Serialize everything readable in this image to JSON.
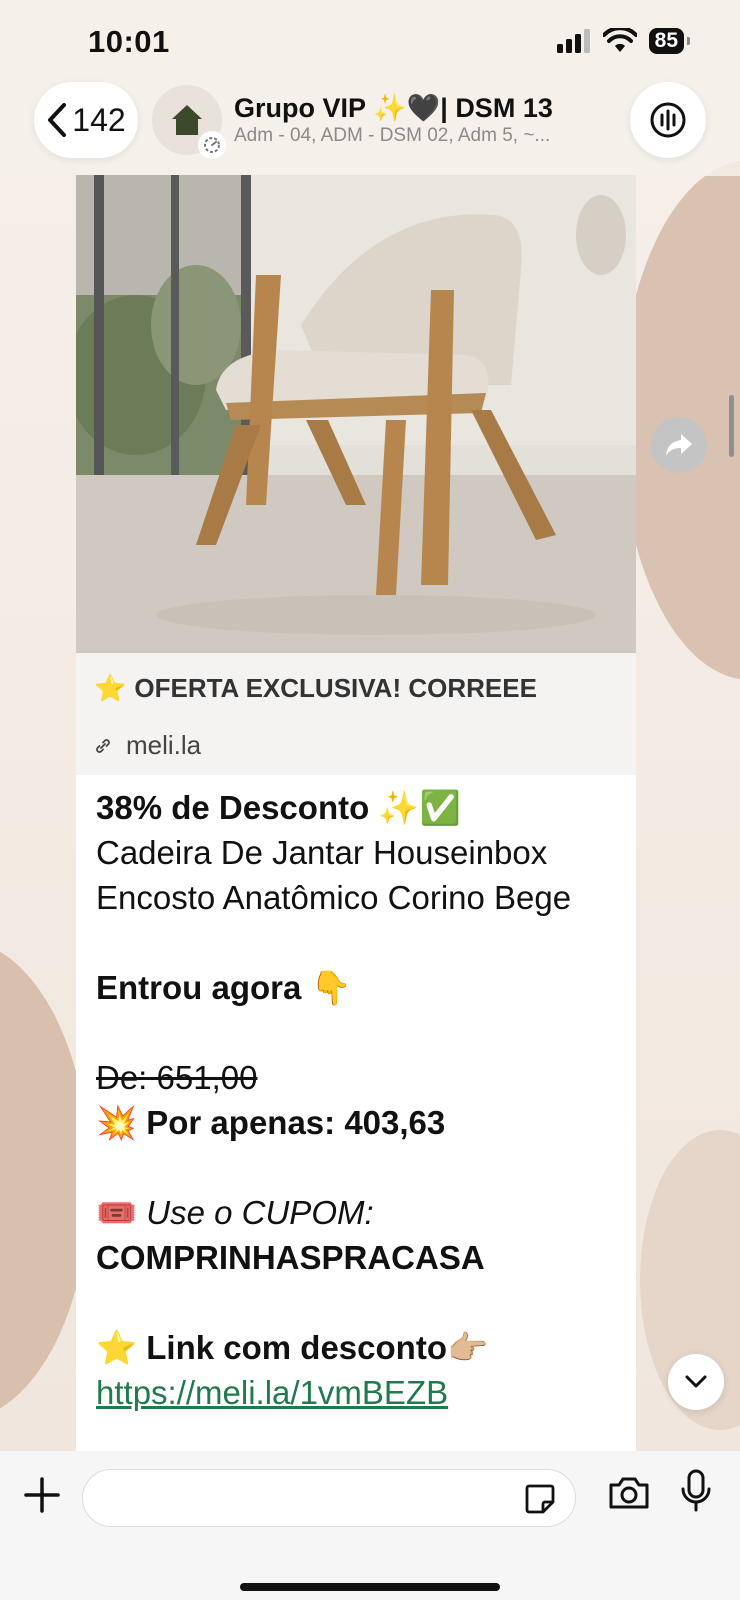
{
  "status": {
    "time": "10:01",
    "battery": "85"
  },
  "header": {
    "back_count": "142",
    "group_title": "Grupo VIP ✨🖤|  DSM 13",
    "group_subtitle": "Adm - 04, ADM - DSM 02, Adm 5, ~..."
  },
  "message": {
    "preview_title": "OFERTA EXCLUSIVA! CORREEE",
    "preview_domain": "meli.la",
    "headline": "38% de Desconto ✨✅",
    "product_line1": "Cadeira De Jantar Houseinbox",
    "product_line2": "Encosto Anatômico Corino  Bege",
    "entrou": "Entrou agora  👇",
    "old_price": "De: 651,00",
    "new_price": "💥 Por apenas:  403,63",
    "coupon_label": "Use o CUPOM:",
    "coupon_code": "COMPRINHASPRACASA",
    "link_label": "Link com desconto👉🏼",
    "link_url": "https://meli.la/1vmBEZB"
  },
  "icons": {
    "back": "chevron-left-icon",
    "avatar": "house-icon",
    "call": "audio-waveform-icon",
    "forward": "forward-arrow-icon",
    "scroll_down": "chevron-down-icon",
    "attach": "plus-icon",
    "sticker": "sticker-icon",
    "camera": "camera-icon",
    "mic": "microphone-icon"
  },
  "colors": {
    "link": "#1f7a4d",
    "bubble": "#ffffff",
    "preview_bg": "#f4f3f1"
  }
}
